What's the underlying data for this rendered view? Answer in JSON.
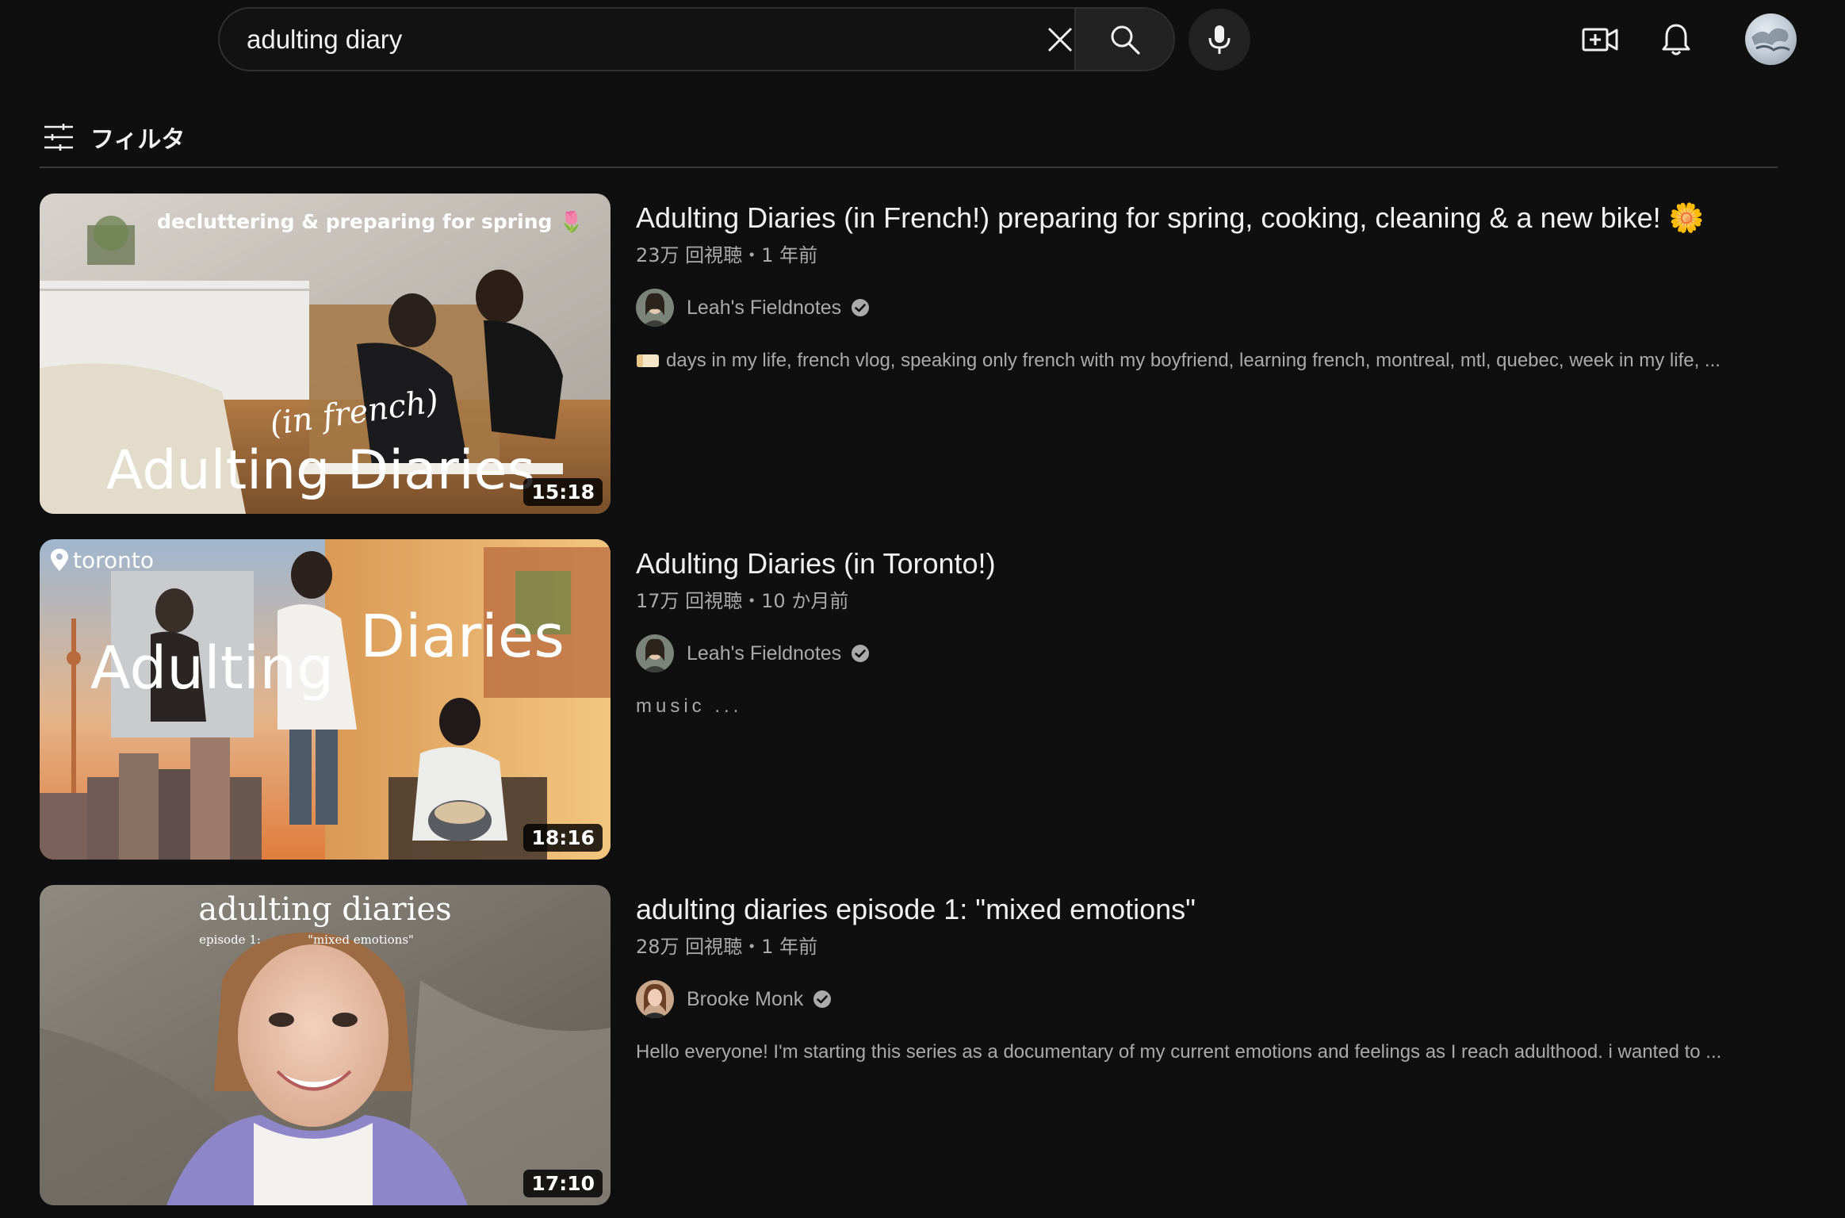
{
  "search": {
    "query": "adulting diary"
  },
  "icons": {
    "clear": "close-icon",
    "search": "search-icon",
    "mic": "microphone-icon",
    "create": "video-create-icon",
    "notifications": "bell-icon",
    "account": "avatar"
  },
  "filter": {
    "label": "フィルタ"
  },
  "results": [
    {
      "title": "Adulting Diaries (in French!) preparing for spring, cooking, cleaning & a new bike! 🌼",
      "meta": "23万 回視聴・1 年前",
      "channel": "Leah's Fieldnotes",
      "verified": true,
      "description": "days in my life, french vlog, speaking only french with my boyfriend, learning french, montreal, mtl, quebec, week in my life, ...",
      "duration": "15:18",
      "thumb_text": {
        "top": "decluttering & preparing for spring 🌷",
        "script": "(in french)",
        "main": "Adulting Diaries"
      }
    },
    {
      "title": "Adulting Diaries (in Toronto!)",
      "meta": "17万 回視聴・10 か月前",
      "channel": "Leah's Fieldnotes",
      "verified": true,
      "description": "music ...",
      "duration": "18:16",
      "thumb_text": {
        "location": "toronto",
        "main_left": "Adulting",
        "main_right": "Diaries"
      }
    },
    {
      "title": "adulting diaries episode 1: \"mixed emotions\"",
      "meta": "28万 回視聴・1 年前",
      "channel": "Brooke Monk",
      "verified": true,
      "description": "Hello everyone! I'm starting this series as a documentary of my current emotions and feelings as I reach adulthood. i wanted to ...",
      "duration": "17:10",
      "thumb_text": {
        "main": "adulting diaries",
        "episode": "episode 1:",
        "subtitle": "\"mixed emotions\""
      }
    }
  ]
}
